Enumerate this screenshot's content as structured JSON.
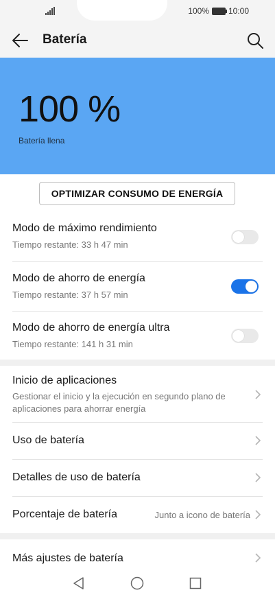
{
  "status": {
    "battery": "100%",
    "time": "10:00"
  },
  "toolbar": {
    "title": "Batería"
  },
  "hero": {
    "percent": "100 %",
    "subtitle": "Batería llena",
    "bg": "#5aa6f3"
  },
  "optimize_label": "OPTIMIZAR CONSUMO DE ENERGÍA",
  "modes": [
    {
      "title": "Modo de máximo rendimiento",
      "subtitle": "Tiempo restante: 33 h 47 min",
      "enabled": false
    },
    {
      "title": "Modo de ahorro de energía",
      "subtitle": "Tiempo restante: 37 h 57 min",
      "enabled": true
    },
    {
      "title": "Modo de ahorro de energía ultra",
      "subtitle": "Tiempo restante: 141 h 31 min",
      "enabled": false
    }
  ],
  "settings": [
    {
      "title": "Inicio de aplicaciones",
      "subtitle": "Gestionar el inicio y la ejecución en segundo plano de aplicaciones para ahorrar energía"
    },
    {
      "title": "Uso de batería"
    },
    {
      "title": "Detalles de uso de batería"
    },
    {
      "title": "Porcentaje de batería",
      "value": "Junto a icono de batería"
    },
    {
      "title": "Más ajustes de batería"
    }
  ],
  "colors": {
    "accent": "#1a73e8",
    "toggle_off": "#e9e9e9"
  },
  "icons": [
    "back-arrow-icon",
    "search-icon",
    "chevron-right-icon",
    "signal-icon",
    "battery-icon",
    "nav-back-icon",
    "nav-home-icon",
    "nav-recents-icon"
  ]
}
